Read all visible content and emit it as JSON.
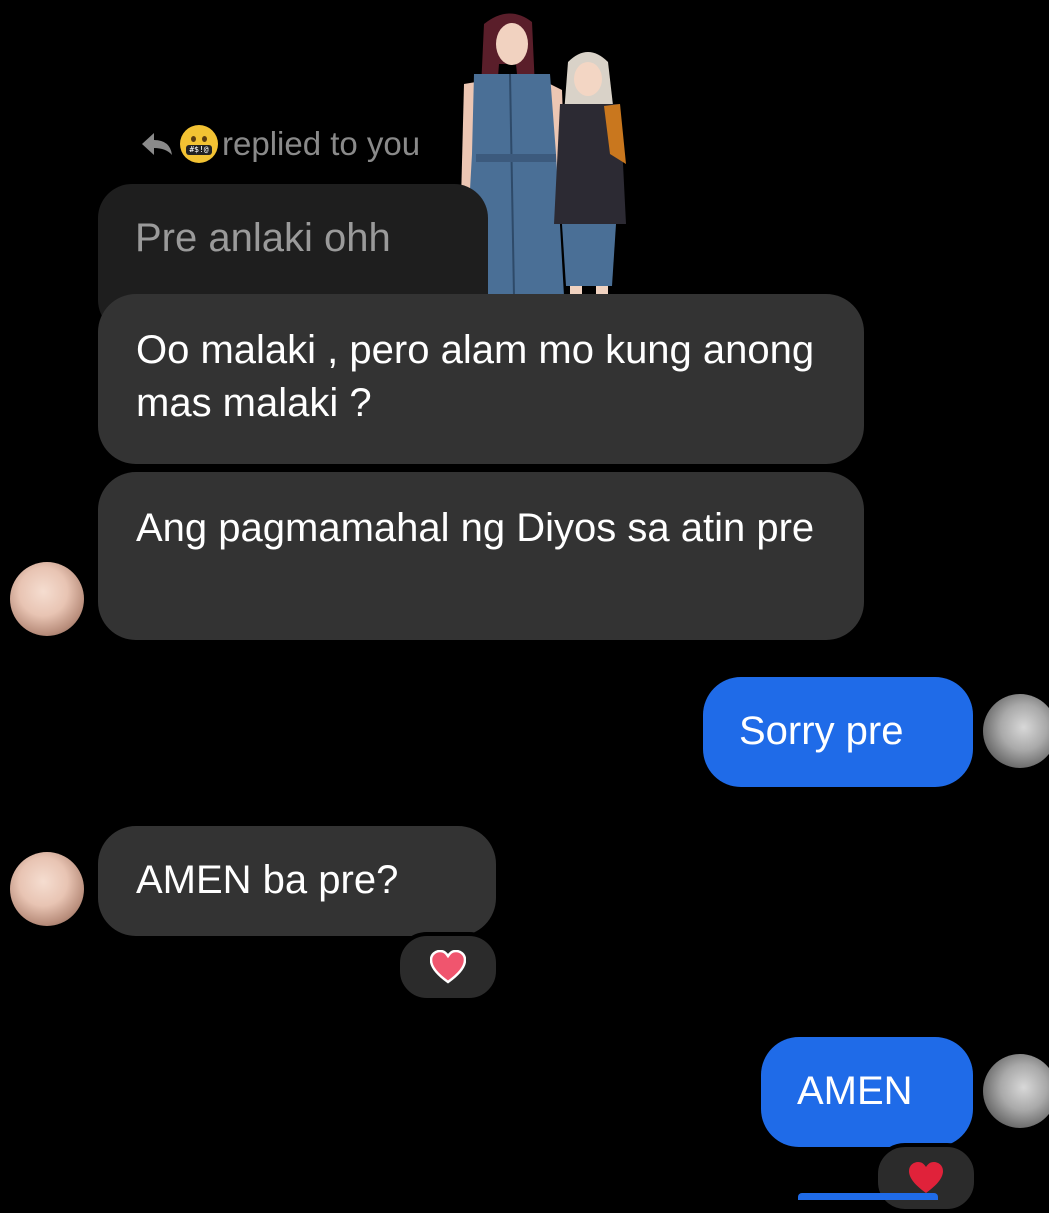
{
  "reply": {
    "label": "replied to you",
    "quoted_text": "Pre anlaki ohh"
  },
  "messages": [
    {
      "side": "in",
      "text": "Oo malaki , pero alam mo kung anong mas malaki ?"
    },
    {
      "side": "in",
      "text": "Ang pagmamahal ng Diyos sa atin pre"
    },
    {
      "side": "out",
      "text": "Sorry pre"
    },
    {
      "side": "in",
      "text": "AMEN  ba pre?"
    },
    {
      "side": "out",
      "text": "AMEN"
    }
  ],
  "reactions": [
    {
      "icon": "heart-icon",
      "color": "#f0556e"
    },
    {
      "icon": "heart-icon",
      "color": "#e0223a"
    }
  ],
  "colors": {
    "incoming_bubble": "#333333",
    "outgoing_bubble": "#1f6be8",
    "background": "#000000"
  }
}
